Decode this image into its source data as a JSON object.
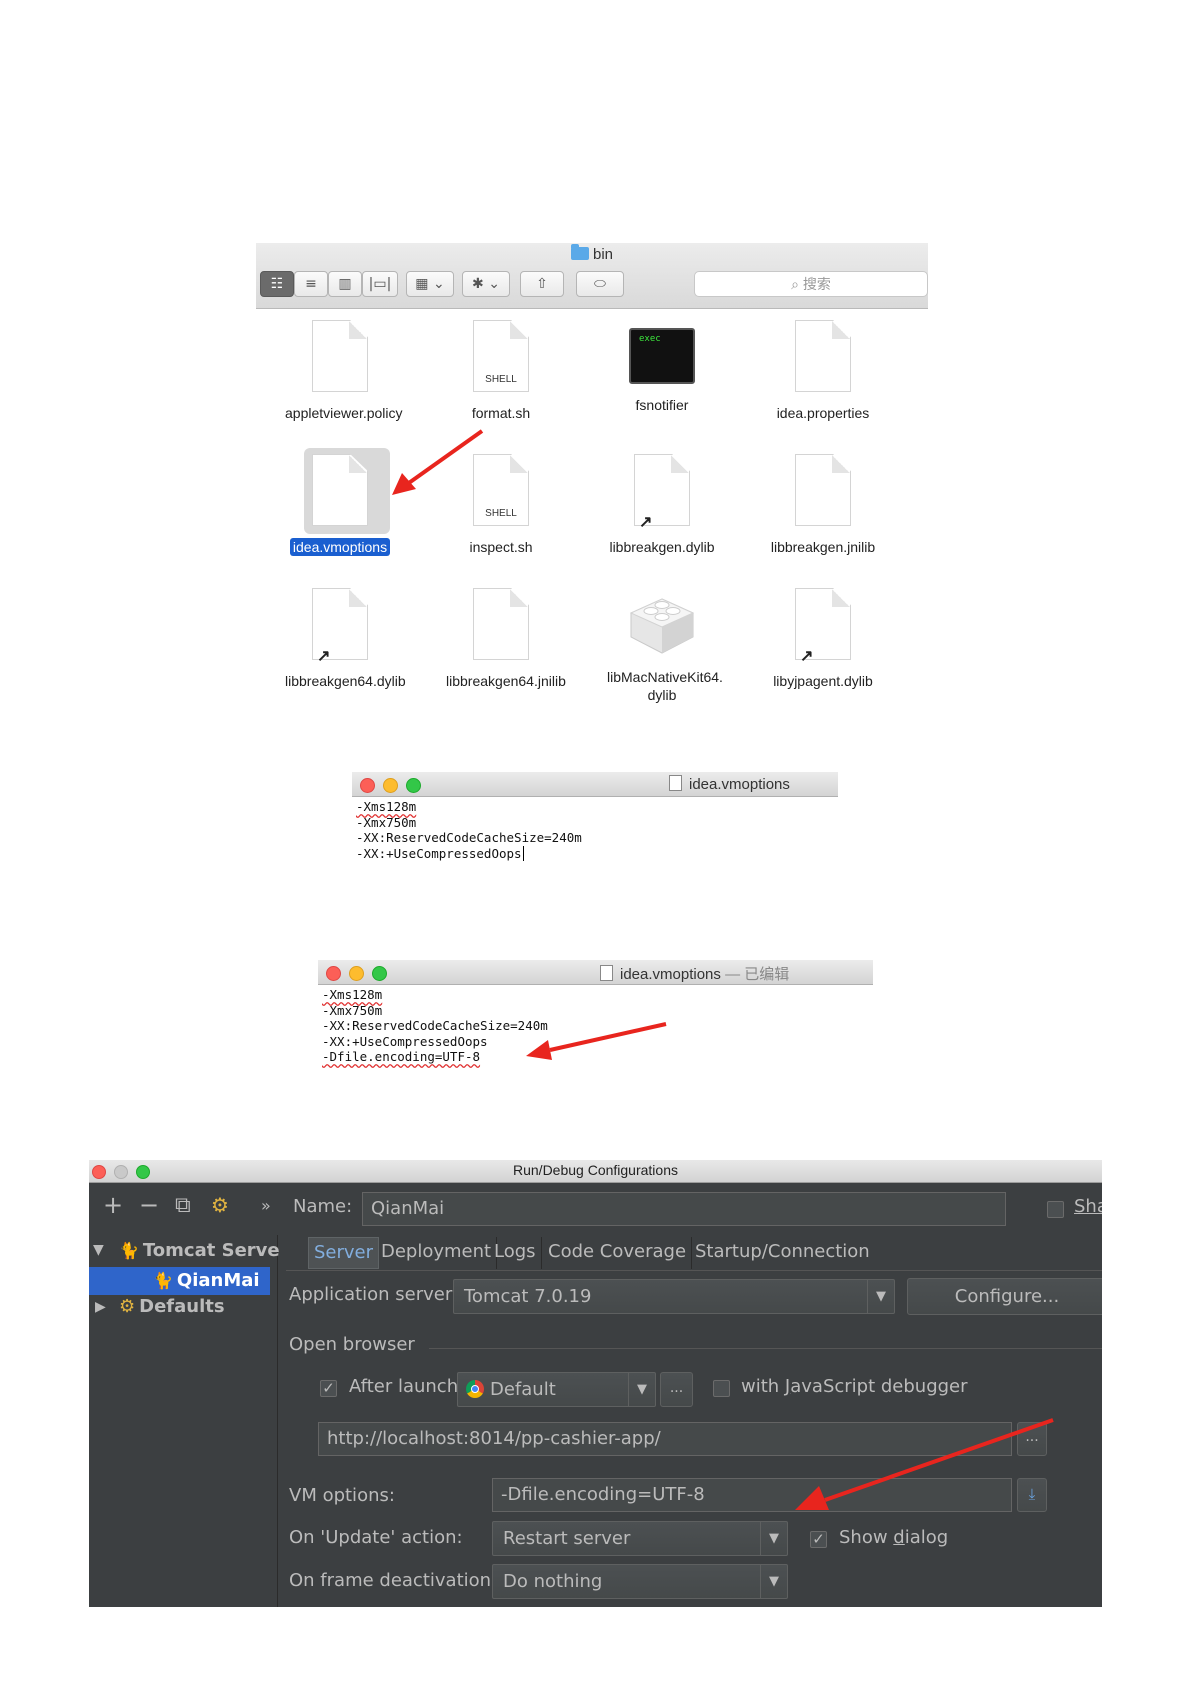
{
  "finder": {
    "title": "bin",
    "search_placeholder": "搜索",
    "toolbar": {
      "icon_view": "☷",
      "list_view": "≡",
      "column_view": "▥",
      "coverflow_view": "|▭|",
      "arrange": "▦ ⌄",
      "action": "✱ ⌄",
      "share": "⇧",
      "tag": "⬭"
    },
    "files": [
      {
        "name": "appletviewer.policy",
        "kind": "doc",
        "tag": ""
      },
      {
        "name": "format.sh",
        "kind": "doc",
        "tag": "SHELL"
      },
      {
        "name": "fsnotifier",
        "kind": "exec",
        "tag": "exec"
      },
      {
        "name": "idea.properties",
        "kind": "doc",
        "tag": ""
      },
      {
        "name": "idea.vmoptions",
        "kind": "doc",
        "tag": "",
        "selected": true
      },
      {
        "name": "inspect.sh",
        "kind": "doc",
        "tag": "SHELL"
      },
      {
        "name": "libbreakgen.dylib",
        "kind": "alias",
        "tag": ""
      },
      {
        "name": "libbreakgen.jnilib",
        "kind": "doc",
        "tag": ""
      },
      {
        "name": "libbreakgen64.dylib",
        "kind": "alias",
        "tag": ""
      },
      {
        "name": "libbreakgen64.jnilib",
        "kind": "doc",
        "tag": ""
      },
      {
        "name": "libMacNativeKit64.",
        "name2": "dylib",
        "kind": "bundle",
        "tag": ""
      },
      {
        "name": "libyjpagent.dylib",
        "kind": "alias",
        "tag": ""
      }
    ],
    "alias_mark": "↗"
  },
  "editor1": {
    "title": "idea.vmoptions",
    "lines": [
      "-Xms128m",
      "-Xmx750m",
      "-XX:ReservedCodeCacheSize=240m",
      "-XX:+UseCompressedOops"
    ]
  },
  "editor2": {
    "title": "idea.vmoptions",
    "status": "— 已编辑",
    "lines": [
      "-Xms128m",
      "-Xmx750m",
      "-XX:ReservedCodeCacheSize=240m",
      "-XX:+UseCompressedOops",
      "-Dfile.encoding=UTF-8"
    ]
  },
  "ide": {
    "title": "Run/Debug Configurations",
    "toolbar": {
      "add": "+",
      "remove": "−",
      "copy": "⧉",
      "edit": "⚙",
      "more": "»"
    },
    "name_label": "Name:",
    "name_value": "QianMai",
    "share_label": "Sha",
    "tree": {
      "tomcat": "Tomcat Serve",
      "qianmai": "QianMai",
      "defaults": "Defaults",
      "expand_open": "▼",
      "expand_closed": "▶"
    },
    "tabs": [
      "Server",
      "Deployment",
      "Logs",
      "Code Coverage",
      "Startup/Connection"
    ],
    "app_server_label": "Application server:",
    "app_server_value": "Tomcat 7.0.19",
    "configure_button": "Configure...",
    "open_browser_label": "Open browser",
    "after_launch_label": "After launch",
    "after_launch_checked": true,
    "browser_value": "Default",
    "browse_button": "...",
    "js_debugger_pre": "with ",
    "js_debugger_u": "J",
    "js_debugger_post": "avaScript debugger",
    "url_value": "http://localhost:8014/pp-cashier-app/",
    "vm_options_label": "VM options:",
    "vm_options_value": "-Dfile.encoding=UTF-8",
    "update_action_label": "On 'Update' action:",
    "update_action_value": "Restart server",
    "show_dialog_pre": "Show ",
    "show_dialog_u": "d",
    "show_dialog_post": "ialog",
    "show_dialog_checked": true,
    "frame_deactivation_label": "On frame deactivation:",
    "frame_deactivation_value": "Do nothing",
    "dropdown_arrow": "▼",
    "check_mark": "✓"
  },
  "colors": {
    "arrow": "#e8251e",
    "selection": "#1a5fd0",
    "ide_bg": "#3c3f41",
    "ide_selection": "#2f65ca"
  }
}
